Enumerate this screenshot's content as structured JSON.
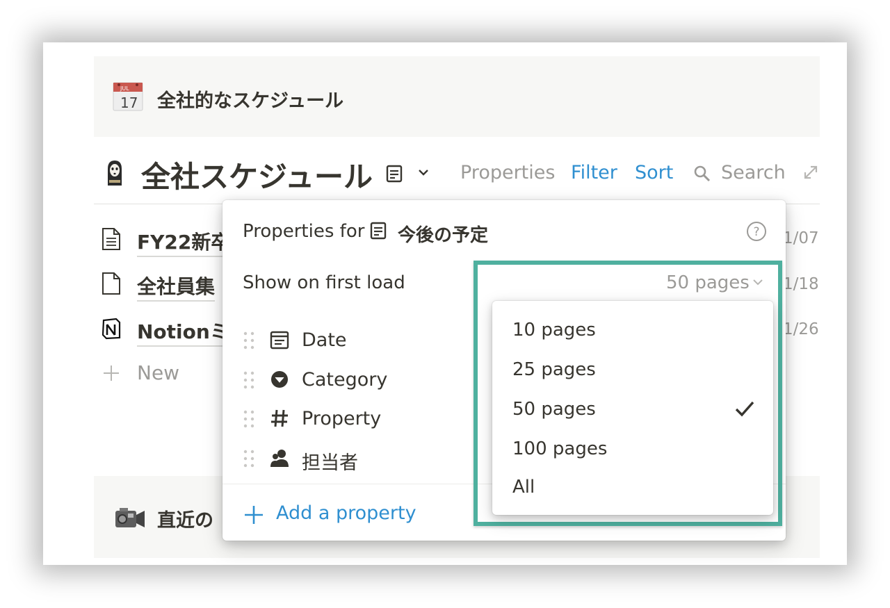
{
  "top_callout": {
    "title": "全社的なスケジュール",
    "calendar_month": "JUL",
    "calendar_day": "17"
  },
  "database": {
    "title": "全社スケジュール",
    "header_buttons": {
      "properties": "Properties",
      "filter": "Filter",
      "sort": "Sort",
      "search": "Search"
    }
  },
  "rows": [
    {
      "label": "FY22新卒",
      "date": "1/07",
      "icon": "page-lines-icon"
    },
    {
      "label": "全社員集",
      "date": "1/18",
      "icon": "page-blank-icon"
    },
    {
      "label": "Notionミ",
      "date": "1/26",
      "icon": "notion-logo-icon"
    }
  ],
  "new_row": "New",
  "bottom_callout": {
    "title": "直近の"
  },
  "popup": {
    "title": "Properties for",
    "view_name": "今後の予定",
    "show_on_first_load": "Show on first load",
    "selected_value": "50 pages",
    "properties": [
      {
        "label": "Date",
        "icon": "calendar-icon"
      },
      {
        "label": "Category",
        "icon": "select-icon"
      },
      {
        "label": "Property",
        "icon": "number-icon"
      },
      {
        "label": "担当者",
        "icon": "person-icon"
      }
    ],
    "add_property": "Add a property"
  },
  "dropdown": {
    "options": [
      "10 pages",
      "25 pages",
      "50 pages",
      "100 pages",
      "All"
    ],
    "selected": "50 pages"
  },
  "colors": {
    "accent_blue": "#2f8fd0",
    "highlight_green": "#4fb09f",
    "muted_text": "#9b9a97"
  }
}
